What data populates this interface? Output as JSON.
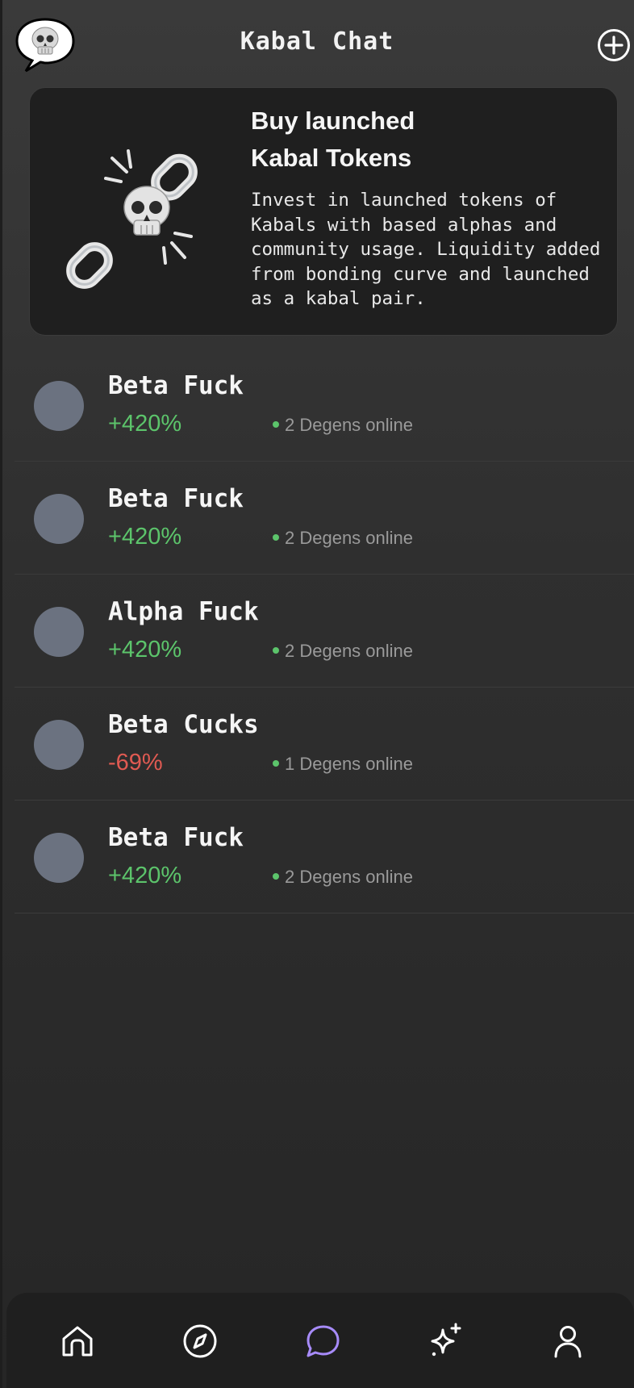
{
  "header": {
    "title": "Kabal Chat",
    "logo_icon": "skull-speech-bubble-icon",
    "add_icon": "plus-circle-icon"
  },
  "promo": {
    "title_line1": "Buy launched",
    "title_line2": "Kabal Tokens",
    "description": "Invest in launched tokens of Kabals with based alphas and community usage. Liquidity added from bonding curve and launched as a kabal pair.",
    "art_icon": "skull-broken-chain-icon"
  },
  "chats": [
    {
      "name": "Beta Fuck",
      "change": "+420%",
      "direction": "up",
      "online": "2 Degens online"
    },
    {
      "name": "Beta Fuck",
      "change": "+420%",
      "direction": "up",
      "online": "2 Degens online"
    },
    {
      "name": "Alpha Fuck",
      "change": "+420%",
      "direction": "up",
      "online": "2 Degens online"
    },
    {
      "name": "Beta Cucks",
      "change": "-69%",
      "direction": "down",
      "online": "1 Degens online"
    },
    {
      "name": "Beta Fuck",
      "change": "+420%",
      "direction": "up",
      "online": "2 Degens online"
    }
  ],
  "nav": {
    "items": [
      {
        "icon": "home-icon",
        "active": false
      },
      {
        "icon": "compass-icon",
        "active": false
      },
      {
        "icon": "chat-bubble-icon",
        "active": true
      },
      {
        "icon": "sparkles-icon",
        "active": false
      },
      {
        "icon": "user-icon",
        "active": false
      }
    ]
  },
  "colors": {
    "positive": "#5cc46b",
    "negative": "#e05a52",
    "nav_active": "#a78bfa",
    "avatar": "#6b7280"
  }
}
